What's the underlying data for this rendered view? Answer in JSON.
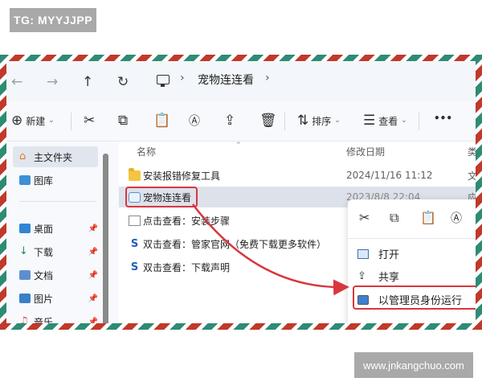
{
  "watermarks": {
    "tg": "TG: MYYJJPP",
    "site": "www.jnkangchuo.com"
  },
  "address_bar": {
    "back_icon": "arrow-left-icon",
    "forward_icon": "arrow-right-icon",
    "up_icon": "arrow-up-icon",
    "refresh_icon": "refresh-icon",
    "breadcrumb": [
      "宠物连连看"
    ]
  },
  "toolbar": {
    "new_label": "新建",
    "sort_label": "排序",
    "view_label": "查看",
    "more_label": "•••"
  },
  "sidebar": {
    "items": [
      {
        "label": "主文件夹",
        "icon": "home-icon",
        "active": true
      },
      {
        "label": "图库",
        "icon": "gallery-icon"
      },
      {
        "label": "桌面",
        "icon": "desktop-icon",
        "pinned": true
      },
      {
        "label": "下载",
        "icon": "download-icon",
        "pinned": true
      },
      {
        "label": "文档",
        "icon": "document-icon",
        "pinned": true
      },
      {
        "label": "图片",
        "icon": "picture-icon",
        "pinned": true
      },
      {
        "label": "音乐",
        "icon": "music-icon",
        "pinned": true
      }
    ]
  },
  "file_list": {
    "columns": {
      "name": "名称",
      "modified": "修改日期",
      "type": "类"
    },
    "rows": [
      {
        "name": "安装报错修复工具",
        "modified": "2024/11/16 11:12",
        "type": "文",
        "icon": "folder-icon"
      },
      {
        "name": "宠物连连看",
        "modified": "2023/8/8 22:04",
        "type": "应",
        "icon": "app-icon",
        "selected": true
      },
      {
        "name": "点击查看：安装步骤",
        "modified": "",
        "type": "",
        "icon": "text-file-icon"
      },
      {
        "name": "双击查看：管家官网（免费下载更多软件）",
        "modified": "",
        "type": "",
        "icon": "link-icon"
      },
      {
        "name": "双击查看：下载声明",
        "modified": "",
        "type": "",
        "icon": "link-icon"
      }
    ]
  },
  "context_menu": {
    "quick_actions": [
      "cut-icon",
      "copy-icon",
      "paste-icon",
      "rename-icon"
    ],
    "items": [
      {
        "label": "打开",
        "icon": "open-icon"
      },
      {
        "label": "共享",
        "icon": "share-icon"
      },
      {
        "label": "以管理员身份运行",
        "icon": "shield-icon",
        "highlighted": true
      }
    ]
  },
  "colors": {
    "highlight": "#d9363e",
    "selection": "#dde2ea",
    "airmail_red": "#c0392b",
    "airmail_green": "#2e8b74"
  }
}
